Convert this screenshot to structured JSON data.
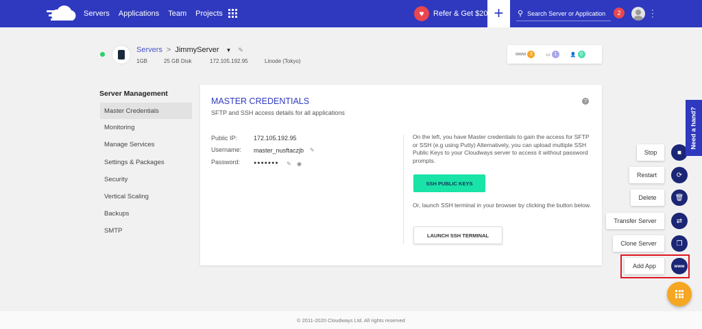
{
  "header": {
    "nav": [
      "Servers",
      "Applications",
      "Team",
      "Projects"
    ],
    "refer_label": "Refer & Get $20",
    "add_symbol": "+",
    "search_placeholder": "Search Server or Application",
    "notification_count": "2"
  },
  "server": {
    "breadcrumb_root": "Servers",
    "breadcrumb_sep": ">",
    "name": "JimmyServer",
    "size": "1GB",
    "disk": "25 GB Disk",
    "ip": "172.105.192.95",
    "location": "Linode (Tokyo)",
    "stats": {
      "www_count": "3",
      "db_count": "1",
      "users_count": "0",
      "www_label": "www"
    }
  },
  "sidebar": {
    "title": "Server Management",
    "items": [
      "Master Credentials",
      "Monitoring",
      "Manage Services",
      "Settings & Packages",
      "Security",
      "Vertical Scaling",
      "Backups",
      "SMTP"
    ]
  },
  "card": {
    "title": "MASTER CREDENTIALS",
    "subtitle": "SFTP and SSH access details for all applications",
    "public_ip_label": "Public IP:",
    "public_ip": "172.105.192.95",
    "username_label": "Username:",
    "username": "master_nusftaczjb",
    "password_label": "Password:",
    "password_mask": "●●●●●●●",
    "info_text": "On the left, you have Master credentials to gain the access for SFTP or SSH (e.g using Putty) Alternatively, you can upload multiple SSH Public Keys to your Cloudways server to access it without password prompts.",
    "ssh_keys_button": "SSH PUBLIC KEYS",
    "terminal_text": "Or, launch SSH terminal in your browser by clicking the button below.",
    "terminal_button": "LAUNCH SSH TERMINAL"
  },
  "actions": [
    {
      "label": "Stop",
      "icon": "■"
    },
    {
      "label": "Restart",
      "icon": "⟳"
    },
    {
      "label": "Delete",
      "icon": "🗑"
    },
    {
      "label": "Transfer Server",
      "icon": "⇄"
    },
    {
      "label": "Clone Server",
      "icon": "❐"
    },
    {
      "label": "Add App",
      "icon": "www"
    }
  ],
  "need_hand": "Need a hand?",
  "footer": "© 2011-2020 Cloudways Ltd. All rights reserved",
  "colors": {
    "brand": "#2f39bf",
    "accent_green": "#19e3a6",
    "fab": "#f5a623",
    "highlight": "#e0161f"
  }
}
